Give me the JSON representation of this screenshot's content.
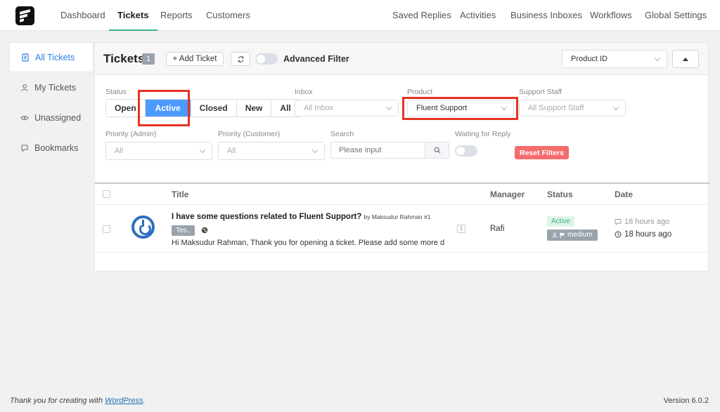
{
  "nav": {
    "left": [
      {
        "label": "Dashboard"
      },
      {
        "label": "Tickets"
      },
      {
        "label": "Reports"
      },
      {
        "label": "Customers"
      }
    ],
    "right": [
      {
        "label": "Saved Replies"
      },
      {
        "label": "Activities"
      },
      {
        "label": "Business Inboxes"
      },
      {
        "label": "Workflows"
      },
      {
        "label": "Global Settings"
      }
    ],
    "active": "Tickets"
  },
  "sidebar": {
    "items": [
      {
        "label": "All Tickets",
        "icon": "document-icon"
      },
      {
        "label": "My Tickets",
        "icon": "user-icon"
      },
      {
        "label": "Unassigned",
        "icon": "eye-icon"
      },
      {
        "label": "Bookmarks",
        "icon": "bookmark-icon"
      }
    ]
  },
  "header": {
    "title": "Tickets",
    "count": "1",
    "add_ticket": "+ Add Ticket",
    "advanced_filter": "Advanced Filter",
    "sort_field": "Product ID"
  },
  "filters": {
    "status_label": "Status",
    "status_options": [
      "Open",
      "Active",
      "Closed",
      "New",
      "All"
    ],
    "status_selected": "Active",
    "inbox_label": "Inbox",
    "inbox_placeholder": "All Inbox",
    "product_label": "Product",
    "product_value": "Fluent Support",
    "staff_label": "Support Staff",
    "staff_placeholder": "All Support Staff",
    "priority_admin_label": "Priority (Admin)",
    "priority_admin_value": "All",
    "priority_customer_label": "Priority (Customer)",
    "priority_customer_value": "All",
    "search_label": "Search",
    "search_placeholder": "Please input",
    "waiting_label": "Waiting for Reply",
    "reset_label": "Reset Filters"
  },
  "table": {
    "columns": {
      "title": "Title",
      "manager": "Manager",
      "status": "Status",
      "date": "Date"
    },
    "rows": [
      {
        "title": "I have some questions related to Fluent Support?",
        "by": "by Maksudur Rahman #1",
        "tag": "Tes..",
        "excerpt": "Hi Maksudur Rahman, Thank you for opening a ticket. Please add some more d",
        "reply_count": "1",
        "manager": "Rafi",
        "status": "Active",
        "priority": "medium",
        "updated": "18 hours ago",
        "created": "18 hours ago"
      }
    ]
  },
  "footer": {
    "thanks_prefix": "Thank you for creating with ",
    "thanks_link": "WordPress",
    "thanks_suffix": ".",
    "version": "Version 6.0.2"
  },
  "colors": {
    "accent_green": "#3fb27f",
    "active_blue": "#4c9aff",
    "reset_red": "#f56c6c",
    "highlight_red": "#e53323",
    "link_blue": "#2f7fe0"
  }
}
